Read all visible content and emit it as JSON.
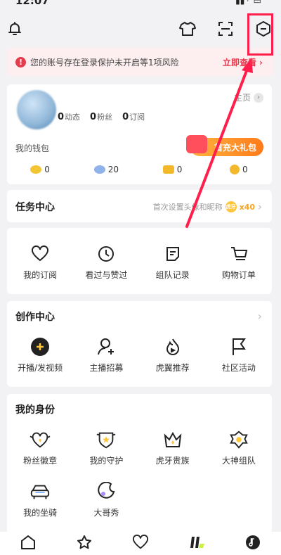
{
  "status_bar": {
    "time": "12:07"
  },
  "top_bar": {
    "icons": [
      "bell-icon",
      "shirt-icon",
      "scan-icon",
      "settings-icon"
    ]
  },
  "risk_banner": {
    "message": "您的账号存在登录保护未开启等1项风险",
    "action": "立即查看"
  },
  "profile": {
    "home_link": "主页",
    "stats": [
      {
        "value": "0",
        "label": "动态"
      },
      {
        "value": "0",
        "label": "粉丝"
      },
      {
        "value": "0",
        "label": "订阅"
      }
    ],
    "wallet_label": "我的钱包",
    "promo_label": "首充大礼包",
    "wallet_items": [
      {
        "value": "0",
        "icon": "gold-bean-icon",
        "color": "#f3c534"
      },
      {
        "value": "20",
        "icon": "silver-bean-icon",
        "color": "#8fb2e8"
      },
      {
        "value": "0",
        "icon": "ticket-icon",
        "color": "#f4b82d"
      },
      {
        "value": "0",
        "icon": "coin-icon",
        "color": "#f4b82d"
      }
    ]
  },
  "task_center": {
    "title": "任务中心",
    "hint": "首次设置头像和昵称",
    "badge": "虎牙币",
    "reward": "x40"
  },
  "quick_links": [
    {
      "label": "我的订阅",
      "icon": "heart-icon"
    },
    {
      "label": "看过与赞过",
      "icon": "clock-icon"
    },
    {
      "label": "组队记录",
      "icon": "note-icon"
    },
    {
      "label": "购物订单",
      "icon": "cart-icon"
    }
  ],
  "creation_center": {
    "title": "创作中心",
    "items": [
      {
        "label": "开播/发视频",
        "icon": "plus-circle-icon"
      },
      {
        "label": "主播招募",
        "icon": "person-add-icon"
      },
      {
        "label": "虎翼推荐",
        "icon": "flame-icon"
      },
      {
        "label": "社区活动",
        "icon": "flag-icon"
      }
    ]
  },
  "identity": {
    "title": "我的身份",
    "items": [
      {
        "label": "粉丝徽章",
        "icon": "fan-badge-icon"
      },
      {
        "label": "我的守护",
        "icon": "shield-star-icon"
      },
      {
        "label": "虎牙贵族",
        "icon": "crown-icon"
      },
      {
        "label": "大神组队",
        "icon": "guild-badge-icon"
      },
      {
        "label": "我的坐骑",
        "icon": "car-icon"
      },
      {
        "label": "大哥秀",
        "icon": "moon-icon"
      }
    ]
  },
  "bottom_nav": [
    "home-icon",
    "star-icon",
    "heart-icon",
    "games-icon",
    "music-icon"
  ],
  "colors": {
    "accent": "#f5a623",
    "alert": "#e63b4c",
    "annotation": "#ff1f4a"
  }
}
